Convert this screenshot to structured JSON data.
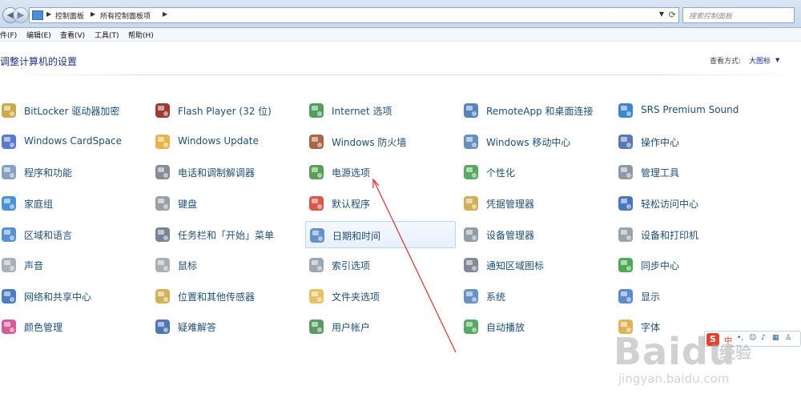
{
  "address": {
    "crumbs": [
      "控制面板",
      "所有控制面板项"
    ],
    "search_placeholder": "搜索控制面板"
  },
  "menu": [
    "件(F)",
    "编辑(E)",
    "查看(V)",
    "工具(T)",
    "帮助(H)"
  ],
  "page_title": "调整计算机的设置",
  "view": {
    "label": "查看方式:",
    "value": "大图标"
  },
  "items": [
    {
      "label": "BitLocker 驱动器加密",
      "icon": "bitlocker-icon",
      "color": "#c49a2c"
    },
    {
      "label": "Flash Player (32 位)",
      "icon": "flash-icon",
      "color": "#8b1a10"
    },
    {
      "label": "Internet 选项",
      "icon": "internet-icon",
      "color": "#2f8f3f"
    },
    {
      "label": "RemoteApp 和桌面连接",
      "icon": "remoteapp-icon",
      "color": "#3a6fb3"
    },
    {
      "label": "SRS Premium Sound",
      "icon": "srs-icon",
      "color": "#1f6fc5"
    },
    {
      "label": "Windows CardSpace",
      "icon": "cardspace-icon",
      "color": "#3a63c4"
    },
    {
      "label": "Windows Update",
      "icon": "windows-update-icon",
      "color": "#e3a62a"
    },
    {
      "label": "Windows 防火墙",
      "icon": "firewall-icon",
      "color": "#9a4a25"
    },
    {
      "label": "Windows 移动中心",
      "icon": "mobility-icon",
      "color": "#4a7cb5"
    },
    {
      "label": "操作中心",
      "icon": "action-center-icon",
      "color": "#3b5fa8"
    },
    {
      "label": "程序和功能",
      "icon": "programs-icon",
      "color": "#6f8fb8"
    },
    {
      "label": "电话和调制解调器",
      "icon": "phone-modem-icon",
      "color": "#707a85"
    },
    {
      "label": "电源选项",
      "icon": "power-options-icon",
      "color": "#3a8f3a"
    },
    {
      "label": "个性化",
      "icon": "personalization-icon",
      "color": "#3c9a4a"
    },
    {
      "label": "管理工具",
      "icon": "admin-tools-icon",
      "color": "#7a8796"
    },
    {
      "label": "家庭组",
      "icon": "homegroup-icon",
      "color": "#2a7fd0"
    },
    {
      "label": "键盘",
      "icon": "keyboard-icon",
      "color": "#8a8f96"
    },
    {
      "label": "默认程序",
      "icon": "default-programs-icon",
      "color": "#d33a2a"
    },
    {
      "label": "凭据管理器",
      "icon": "credential-icon",
      "color": "#c9a03a"
    },
    {
      "label": "轻松访问中心",
      "icon": "ease-of-access-icon",
      "color": "#2a5fb0"
    },
    {
      "label": "区域和语言",
      "icon": "region-icon",
      "color": "#3b7fc8"
    },
    {
      "label": "任务栏和「开始」菜单",
      "icon": "taskbar-icon",
      "color": "#5f6f80"
    },
    {
      "label": "日期和时间",
      "icon": "date-time-icon",
      "color": "#4d7fbf"
    },
    {
      "label": "设备管理器",
      "icon": "device-manager-icon",
      "color": "#7f8c99"
    },
    {
      "label": "设备和打印机",
      "icon": "printer-icon",
      "color": "#8a939c"
    },
    {
      "label": "声音",
      "icon": "sound-icon",
      "color": "#9aa3ac"
    },
    {
      "label": "鼠标",
      "icon": "mouse-icon",
      "color": "#9aa1a8"
    },
    {
      "label": "索引选项",
      "icon": "indexing-icon",
      "color": "#8c98a6"
    },
    {
      "label": "通知区域图标",
      "icon": "notification-icon",
      "color": "#6b7785"
    },
    {
      "label": "同步中心",
      "icon": "sync-icon",
      "color": "#2f9a3a"
    },
    {
      "label": "网络和共享中心",
      "icon": "network-icon",
      "color": "#2a66b8"
    },
    {
      "label": "位置和其他传感器",
      "icon": "sensor-icon",
      "color": "#c9a63a"
    },
    {
      "label": "文件夹选项",
      "icon": "folder-options-icon",
      "color": "#e0b84a"
    },
    {
      "label": "系统",
      "icon": "system-icon",
      "color": "#4e7fb8"
    },
    {
      "label": "显示",
      "icon": "display-icon",
      "color": "#3e78c0"
    },
    {
      "label": "颜色管理",
      "icon": "color-management-icon",
      "color": "#d23a8a"
    },
    {
      "label": "疑难解答",
      "icon": "troubleshoot-icon",
      "color": "#2f5fa8"
    },
    {
      "label": "用户帐户",
      "icon": "user-accounts-icon",
      "color": "#3d8a4a"
    },
    {
      "label": "自动播放",
      "icon": "autoplay-icon",
      "color": "#3b9a4a"
    },
    {
      "label": "字体",
      "icon": "fonts-icon",
      "color": "#d9a43a"
    }
  ],
  "ime": {
    "logo": "S",
    "text": "中"
  },
  "watermark": {
    "brand": "Baidu",
    "brand_cn": "经验",
    "url": "jingyan.baidu.com"
  }
}
